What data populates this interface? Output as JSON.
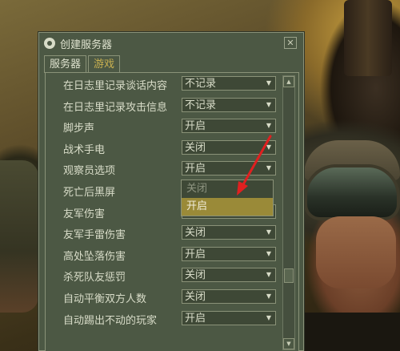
{
  "window": {
    "title": "创建服务器",
    "close_glyph": "✕"
  },
  "tabs": [
    {
      "label": "服务器",
      "active": false
    },
    {
      "label": "游戏",
      "active": true
    }
  ],
  "settings": [
    {
      "label": "在日志里记录谈话内容",
      "value": "不记录"
    },
    {
      "label": "在日志里记录攻击信息",
      "value": "不记录"
    },
    {
      "label": "脚步声",
      "value": "开启"
    },
    {
      "label": "战术手电",
      "value": "关闭"
    },
    {
      "label": "观察员选项",
      "value": "开启"
    },
    {
      "label": "死亡后黑屏",
      "value": ""
    },
    {
      "label": "友军伤害",
      "value": "关闭"
    },
    {
      "label": "友军手雷伤害",
      "value": "关闭"
    },
    {
      "label": "高处坠落伤害",
      "value": "开启"
    },
    {
      "label": "杀死队友惩罚",
      "value": "关闭"
    },
    {
      "label": "自动平衡双方人数",
      "value": "关闭"
    },
    {
      "label": "自动踢出不动的玩家",
      "value": "开启"
    }
  ],
  "dropdown": {
    "options": [
      "关闭",
      "开启"
    ],
    "highlighted": "开启"
  },
  "icons": {
    "app": "steam-icon",
    "close": "close-icon",
    "arrow": "chevron-down-icon",
    "scroll_up": "scroll-up-icon",
    "scroll_down": "scroll-down-icon"
  },
  "colors": {
    "dialog_bg": "#4c5844",
    "active_tab": "#c8b050",
    "highlight": "#9a8a38",
    "annotation": "#e02020"
  }
}
